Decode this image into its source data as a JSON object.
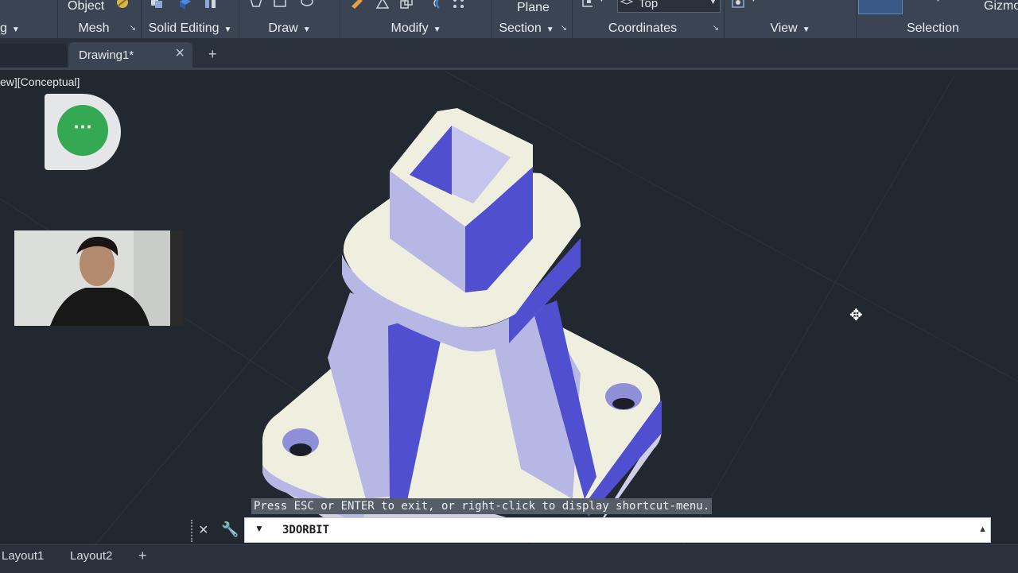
{
  "ribbon": {
    "top_labels": {
      "object": "Object",
      "plane": "Plane",
      "view_name": "Top",
      "gizmo": "Gizmo"
    },
    "panels": [
      {
        "label": "g",
        "dropdown": "▼"
      },
      {
        "label": "Mesh",
        "launcher": "↘"
      },
      {
        "label": "Solid Editing",
        "dropdown": "▼"
      },
      {
        "label": "Draw",
        "dropdown": "▼"
      },
      {
        "label": "Modify",
        "dropdown": "▼"
      },
      {
        "label": "Section",
        "dropdown": "▼",
        "launcher": "↘"
      },
      {
        "label": "Coordinates",
        "launcher": "↘"
      },
      {
        "label": "View",
        "dropdown": "▼"
      },
      {
        "label": "Selection"
      }
    ]
  },
  "tabs": {
    "active": {
      "title": "Drawing1*",
      "close": "×"
    },
    "add": "+"
  },
  "viewport": {
    "label": "ew][Conceptual]",
    "orbit_cursor": "orbit-cursor-icon"
  },
  "overlay": {
    "meeting_button": "⋯",
    "webcam": "webcam-feed"
  },
  "command": {
    "prompt": "Press ESC or ENTER to exit, or right-click to display shortcut-menu.",
    "close": "×",
    "customize": "wrench-icon",
    "value": "3DORBIT",
    "caret": "▼",
    "history": "▲"
  },
  "status": {
    "layouts": [
      "Layout1",
      "Layout2"
    ],
    "add": "+"
  },
  "colors": {
    "background": "#212830",
    "ribbon": "#3b4453",
    "model_face": "#efefe0",
    "model_side": "#b7b7e6",
    "model_shadow": "#4f4fd0",
    "meeting_green": "#34a853"
  }
}
